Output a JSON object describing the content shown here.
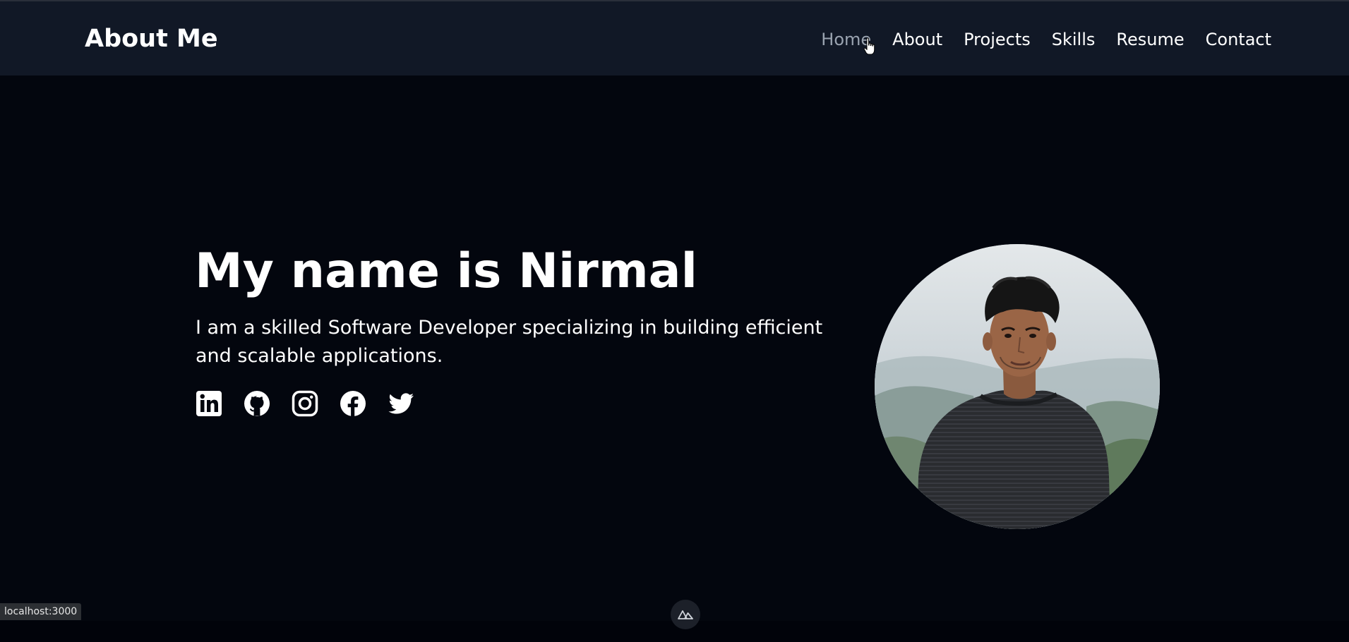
{
  "header": {
    "brand": "About Me",
    "nav": [
      "Home",
      "About",
      "Projects",
      "Skills",
      "Resume",
      "Contact"
    ],
    "active": "Home"
  },
  "hero": {
    "title": "My name is Nirmal",
    "subtitle": "I am a skilled Software Developer specializing in building efficient and scalable applications."
  },
  "socials": [
    {
      "name": "linkedin-icon"
    },
    {
      "name": "github-icon"
    },
    {
      "name": "instagram-icon"
    },
    {
      "name": "facebook-icon"
    },
    {
      "name": "twitter-icon"
    }
  ],
  "status": {
    "url": "localhost:3000"
  },
  "colors": {
    "background": "#03060e",
    "navbar": "#111826",
    "active_link": "#9aa3b0",
    "text": "#ffffff"
  }
}
